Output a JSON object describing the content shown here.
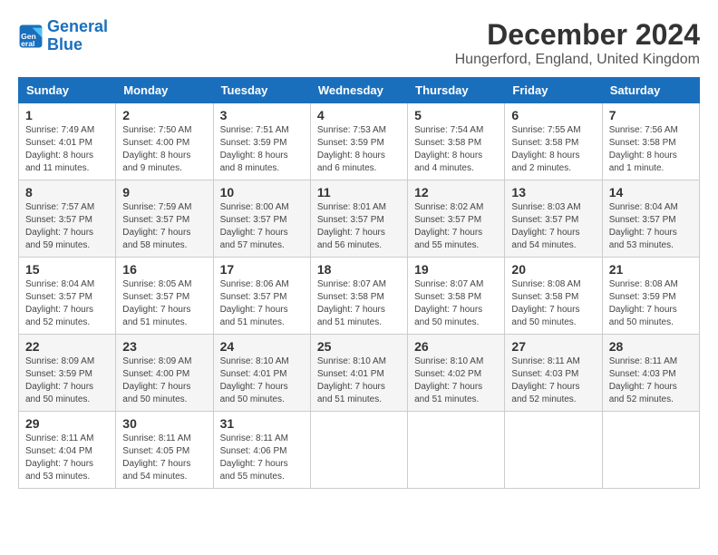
{
  "logo": {
    "line1": "General",
    "line2": "Blue"
  },
  "title": "December 2024",
  "subtitle": "Hungerford, England, United Kingdom",
  "header_days": [
    "Sunday",
    "Monday",
    "Tuesday",
    "Wednesday",
    "Thursday",
    "Friday",
    "Saturday"
  ],
  "weeks": [
    [
      {
        "day": "1",
        "detail": "Sunrise: 7:49 AM\nSunset: 4:01 PM\nDaylight: 8 hours\nand 11 minutes."
      },
      {
        "day": "2",
        "detail": "Sunrise: 7:50 AM\nSunset: 4:00 PM\nDaylight: 8 hours\nand 9 minutes."
      },
      {
        "day": "3",
        "detail": "Sunrise: 7:51 AM\nSunset: 3:59 PM\nDaylight: 8 hours\nand 8 minutes."
      },
      {
        "day": "4",
        "detail": "Sunrise: 7:53 AM\nSunset: 3:59 PM\nDaylight: 8 hours\nand 6 minutes."
      },
      {
        "day": "5",
        "detail": "Sunrise: 7:54 AM\nSunset: 3:58 PM\nDaylight: 8 hours\nand 4 minutes."
      },
      {
        "day": "6",
        "detail": "Sunrise: 7:55 AM\nSunset: 3:58 PM\nDaylight: 8 hours\nand 2 minutes."
      },
      {
        "day": "7",
        "detail": "Sunrise: 7:56 AM\nSunset: 3:58 PM\nDaylight: 8 hours\nand 1 minute."
      }
    ],
    [
      {
        "day": "8",
        "detail": "Sunrise: 7:57 AM\nSunset: 3:57 PM\nDaylight: 7 hours\nand 59 minutes."
      },
      {
        "day": "9",
        "detail": "Sunrise: 7:59 AM\nSunset: 3:57 PM\nDaylight: 7 hours\nand 58 minutes."
      },
      {
        "day": "10",
        "detail": "Sunrise: 8:00 AM\nSunset: 3:57 PM\nDaylight: 7 hours\nand 57 minutes."
      },
      {
        "day": "11",
        "detail": "Sunrise: 8:01 AM\nSunset: 3:57 PM\nDaylight: 7 hours\nand 56 minutes."
      },
      {
        "day": "12",
        "detail": "Sunrise: 8:02 AM\nSunset: 3:57 PM\nDaylight: 7 hours\nand 55 minutes."
      },
      {
        "day": "13",
        "detail": "Sunrise: 8:03 AM\nSunset: 3:57 PM\nDaylight: 7 hours\nand 54 minutes."
      },
      {
        "day": "14",
        "detail": "Sunrise: 8:04 AM\nSunset: 3:57 PM\nDaylight: 7 hours\nand 53 minutes."
      }
    ],
    [
      {
        "day": "15",
        "detail": "Sunrise: 8:04 AM\nSunset: 3:57 PM\nDaylight: 7 hours\nand 52 minutes."
      },
      {
        "day": "16",
        "detail": "Sunrise: 8:05 AM\nSunset: 3:57 PM\nDaylight: 7 hours\nand 51 minutes."
      },
      {
        "day": "17",
        "detail": "Sunrise: 8:06 AM\nSunset: 3:57 PM\nDaylight: 7 hours\nand 51 minutes."
      },
      {
        "day": "18",
        "detail": "Sunrise: 8:07 AM\nSunset: 3:58 PM\nDaylight: 7 hours\nand 51 minutes."
      },
      {
        "day": "19",
        "detail": "Sunrise: 8:07 AM\nSunset: 3:58 PM\nDaylight: 7 hours\nand 50 minutes."
      },
      {
        "day": "20",
        "detail": "Sunrise: 8:08 AM\nSunset: 3:58 PM\nDaylight: 7 hours\nand 50 minutes."
      },
      {
        "day": "21",
        "detail": "Sunrise: 8:08 AM\nSunset: 3:59 PM\nDaylight: 7 hours\nand 50 minutes."
      }
    ],
    [
      {
        "day": "22",
        "detail": "Sunrise: 8:09 AM\nSunset: 3:59 PM\nDaylight: 7 hours\nand 50 minutes."
      },
      {
        "day": "23",
        "detail": "Sunrise: 8:09 AM\nSunset: 4:00 PM\nDaylight: 7 hours\nand 50 minutes."
      },
      {
        "day": "24",
        "detail": "Sunrise: 8:10 AM\nSunset: 4:01 PM\nDaylight: 7 hours\nand 50 minutes."
      },
      {
        "day": "25",
        "detail": "Sunrise: 8:10 AM\nSunset: 4:01 PM\nDaylight: 7 hours\nand 51 minutes."
      },
      {
        "day": "26",
        "detail": "Sunrise: 8:10 AM\nSunset: 4:02 PM\nDaylight: 7 hours\nand 51 minutes."
      },
      {
        "day": "27",
        "detail": "Sunrise: 8:11 AM\nSunset: 4:03 PM\nDaylight: 7 hours\nand 52 minutes."
      },
      {
        "day": "28",
        "detail": "Sunrise: 8:11 AM\nSunset: 4:03 PM\nDaylight: 7 hours\nand 52 minutes."
      }
    ],
    [
      {
        "day": "29",
        "detail": "Sunrise: 8:11 AM\nSunset: 4:04 PM\nDaylight: 7 hours\nand 53 minutes."
      },
      {
        "day": "30",
        "detail": "Sunrise: 8:11 AM\nSunset: 4:05 PM\nDaylight: 7 hours\nand 54 minutes."
      },
      {
        "day": "31",
        "detail": "Sunrise: 8:11 AM\nSunset: 4:06 PM\nDaylight: 7 hours\nand 55 minutes."
      },
      null,
      null,
      null,
      null
    ]
  ]
}
